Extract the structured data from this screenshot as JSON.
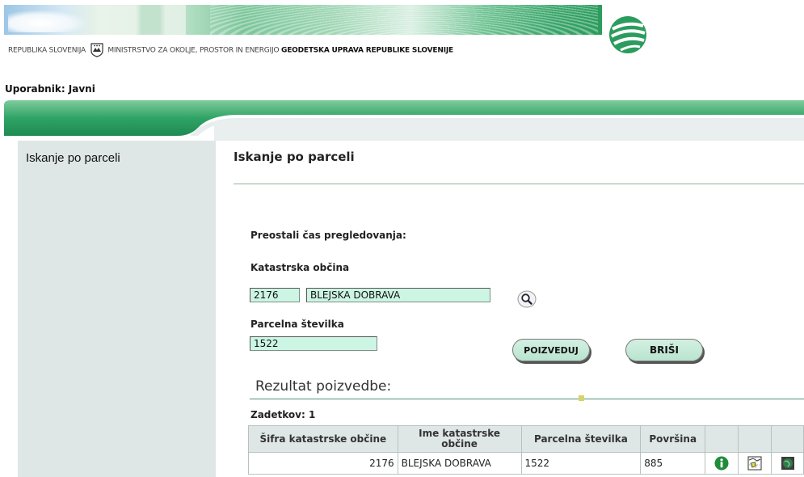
{
  "header": {
    "republic": "REPUBLIKA SLOVENIJA",
    "ministry": "MINISTRSTVO ZA OKOLJE, PROSTOR IN ENERGIJO",
    "agency": "GEODETSKA UPRAVA REPUBLIKE SLOVENIJE"
  },
  "user": {
    "label": "Uporabnik: Javni"
  },
  "sidebar": {
    "items": [
      {
        "label": "Iskanje po parceli"
      }
    ]
  },
  "main": {
    "title": "Iskanje po parceli",
    "remaining_time_label": "Preostali čas pregledovanja:",
    "cadastral_label": "Katastrska občina",
    "cadastral_code": "2176",
    "cadastral_name": "BLEJSKA DOBRAVA",
    "parcel_label": "Parcelna številka",
    "parcel_value": "1522",
    "query_button": "POIZVEDUJ",
    "clear_button": "BRIŠI"
  },
  "results": {
    "title": "Rezultat poizvedbe:",
    "count_label": "Zadetkov: 1",
    "columns": [
      "Šifra katastrske občine",
      "Ime katastrske občine",
      "Parcelna številka",
      "Površina"
    ],
    "rows": [
      {
        "code": "2176",
        "name": "BLEJSKA DOBRAVA",
        "parcel": "1522",
        "area": "885"
      }
    ],
    "row_icons": [
      "info-icon",
      "map-icon",
      "globe-icon"
    ]
  },
  "colors": {
    "accent_green": "#2b9c5d",
    "field_bg": "#ccf5e4",
    "sidebar_bg": "#dfe7e6"
  }
}
